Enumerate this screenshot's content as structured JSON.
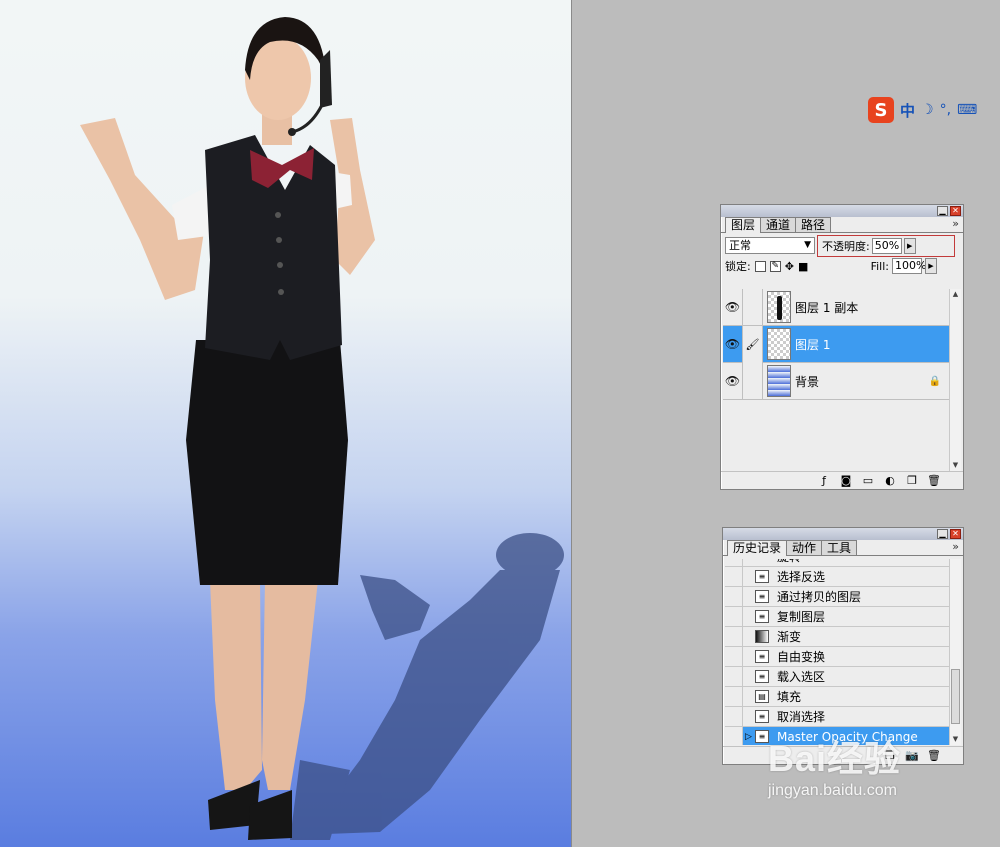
{
  "ime": {
    "logo": "S",
    "mode": "中",
    "moon": "☽",
    "punct": "°,",
    "keyboard": "⌨"
  },
  "layers_palette": {
    "tabs": [
      {
        "label": "图层"
      },
      {
        "label": "通道"
      },
      {
        "label": "路径"
      }
    ],
    "more": "»",
    "blend_mode": "正常",
    "opacity_label": "不透明度:",
    "opacity_value": "50%",
    "lock_label": "锁定:",
    "fill_label": "Fill:",
    "fill_value": "100%",
    "layers": [
      {
        "name": "图层 1 副本"
      },
      {
        "name": "图层 1"
      },
      {
        "name": "背景"
      }
    ],
    "icons": [
      "link-icon",
      "add-style-icon",
      "mask-icon",
      "new-group-icon",
      "adjustment-icon",
      "new-layer-icon",
      "trash-icon"
    ]
  },
  "history_palette": {
    "tabs": [
      {
        "label": "历史记录"
      },
      {
        "label": "动作"
      },
      {
        "label": "工具"
      }
    ],
    "more": "»",
    "partial_item": "旋转",
    "items": [
      {
        "name": "选择反选"
      },
      {
        "name": "通过拷贝的图层"
      },
      {
        "name": "复制图层"
      },
      {
        "name": "渐变"
      },
      {
        "name": "自由变换"
      },
      {
        "name": "载入选区"
      },
      {
        "name": "填充"
      },
      {
        "name": "取消选择"
      },
      {
        "name": "Master Opacity Change"
      }
    ]
  },
  "watermark": {
    "brand": "Bai经验",
    "url": "jingyan.baidu.com"
  },
  "colors": {
    "selection": "#3d9bf0",
    "canvas_bottom": "#5a7de0",
    "ime_blue": "#1552b8",
    "ime_logo": "#e8431e"
  }
}
